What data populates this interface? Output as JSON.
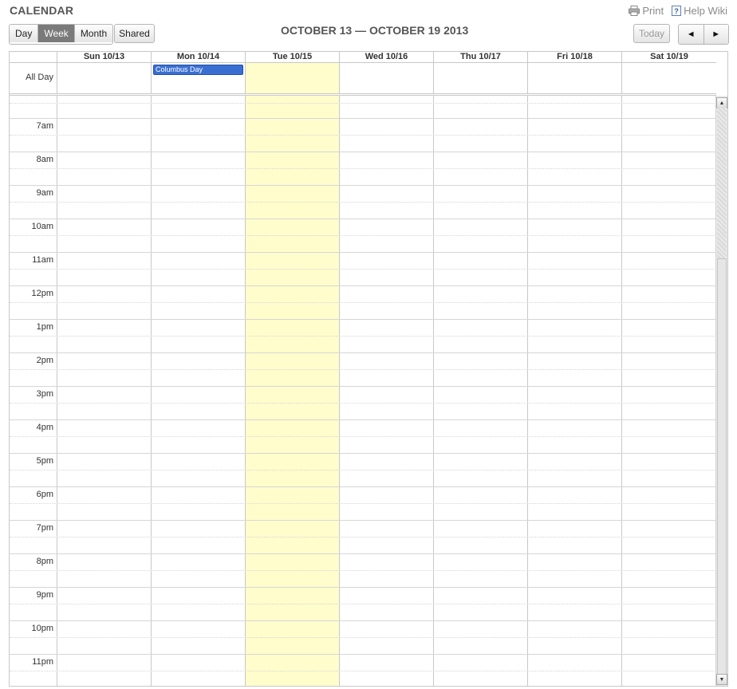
{
  "app": {
    "title": "CALENDAR"
  },
  "top_links": {
    "print_label": "Print",
    "print_icon": "printer-icon",
    "help_label": "Help Wiki",
    "help_icon": "help-icon"
  },
  "toolbar": {
    "views": [
      "Day",
      "Week",
      "Month"
    ],
    "active_view": "Week",
    "shared_label": "Shared",
    "week_range": "OCTOBER 13 — OCTOBER 19 2013",
    "today_label": "Today",
    "prev_symbol": "◄",
    "next_symbol": "►"
  },
  "calendar": {
    "all_day_label": "All Day",
    "days": [
      "Sun 10/13",
      "Mon 10/14",
      "Tue 10/15",
      "Wed 10/16",
      "Thu 10/17",
      "Fri 10/18",
      "Sat 10/19"
    ],
    "today_index": 2,
    "all_day_events": [
      {
        "day_index": 1,
        "title": "Columbus Day",
        "color": "#3a6fd2"
      }
    ],
    "hours": [
      "7am",
      "8am",
      "9am",
      "10am",
      "11am",
      "12pm",
      "1pm",
      "2pm",
      "3pm",
      "4pm",
      "5pm",
      "6pm",
      "7pm",
      "8pm",
      "9pm",
      "10pm",
      "11pm"
    ]
  },
  "colors": {
    "today_highlight": "#fffdcc",
    "active_view": "#7a7a7a",
    "event": "#3a6fd2"
  }
}
